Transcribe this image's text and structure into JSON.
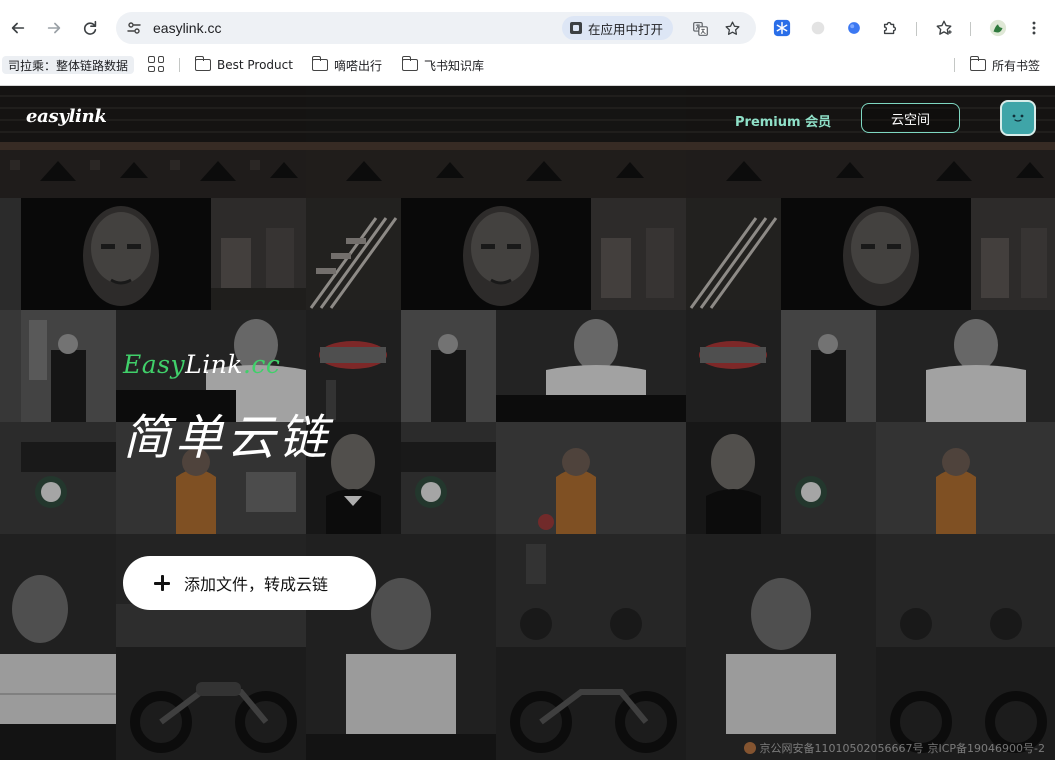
{
  "browser": {
    "url": "easylink.cc",
    "open_in_app": "在应用中打开",
    "bookmarks": [
      "司拉乘：整体链路数据",
      "Best Product",
      "嘀嗒出行",
      "飞书知识库"
    ],
    "all_bookmarks": "所有书签"
  },
  "nav": {
    "logo": "easylink",
    "premium": "Premium 会员",
    "cloud_space": "云空间"
  },
  "hero": {
    "brand_part1": "Easy",
    "brand_part2": "Link",
    "brand_part3": ".cc",
    "title": "简单云链",
    "add_button": "添加文件，转成云链"
  },
  "footer": {
    "police_record": "京公网安备11010502056667号",
    "icp": "京ICP备19046900号-2"
  },
  "colors": {
    "accent": "#7ed7c1",
    "brand_green": "#40d06a",
    "avatar_bg": "#3fa5a8"
  }
}
